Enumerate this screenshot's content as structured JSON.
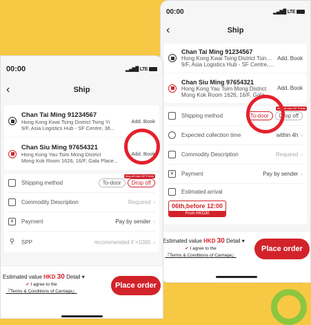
{
  "status": {
    "time": "00:00",
    "network": "LTE"
  },
  "nav": {
    "title": "Ship"
  },
  "sender": {
    "name": "Chan Tai Ming 91234567",
    "line1": "Hong Kong Kwai Tsing District Tsing Yi",
    "line2": "9/F, Asia Logistics Hub - SF Centre, 36...",
    "action": "Add. Book"
  },
  "receiver": {
    "name": "Chan Siu Ming 97654321",
    "line1": "Hong Kong Yau Tsim Mong District",
    "line2": "Mong Kok Room 1626, 16/F, Gala Place...",
    "line2_short": "Mong Kok Room 1626, 16/F, Gala Place",
    "action": "Add. Book"
  },
  "rows": {
    "shipping_method": "Shipping method",
    "to_door": "To-door",
    "drop_off": "Drop off",
    "drop_off_tag": "drop-off earn SF Points",
    "collection": "Expected collection time",
    "collection_value": "within 4h",
    "commodity": "Commodity Description",
    "commodity_value": "Required",
    "payment": "Payment",
    "payment_value": "Pay by sender",
    "spp": "SPP",
    "spp_value": "recommended if >1000",
    "arrival": "Estimated arrival",
    "arrival_time": "06th,before 12:00",
    "arrival_price": "From HKD30"
  },
  "footer": {
    "estimated_label": "Estimated value",
    "currency": "HKD",
    "amount": "30",
    "detail": "Detail",
    "agree": "I agree to the",
    "terms": "『Terms & Conditions of Carriage』",
    "place_order": "Place order"
  },
  "colors": {
    "accent": "#d2232a",
    "background": "#f7c844"
  }
}
